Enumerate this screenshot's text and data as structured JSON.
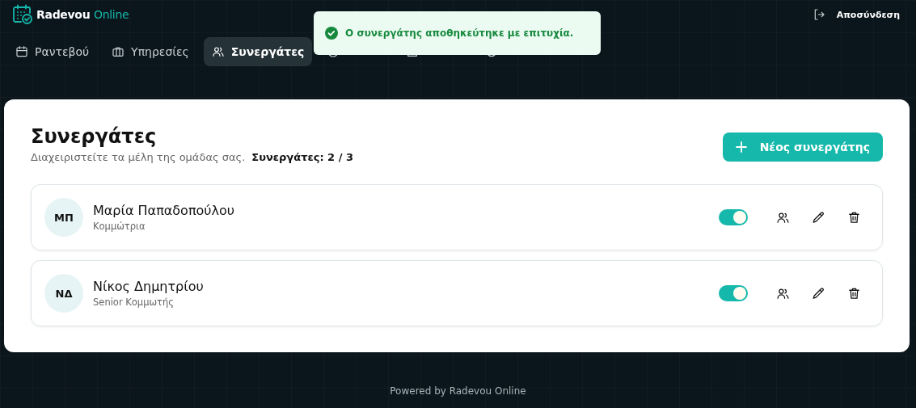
{
  "brand": {
    "name": "Radevou",
    "suffix": "Online"
  },
  "logout": {
    "label": "Αποσύνδεση"
  },
  "tabs": [
    {
      "label": "Ραντεβού",
      "selected": false
    },
    {
      "label": "Υπηρεσίες",
      "selected": false
    },
    {
      "label": "Συνεργάτες",
      "selected": true
    },
    {
      "selected": false
    },
    {
      "selected": false
    },
    {
      "selected": false
    }
  ],
  "toast": {
    "kind": "success",
    "message": "Ο συνεργάτης αποθηκεύτηκε με επιτυχία."
  },
  "page": {
    "title": "Συνεργάτες",
    "subtitle": "Διαχειριστείτε τα μέλη της ομάδας σας.",
    "count": "Συνεργάτες: 2 / 3",
    "new_button": "Νέος συνεργάτης"
  },
  "partners": [
    {
      "initials": "ΜΠ",
      "name": "Μαρία Παπαδοπούλου",
      "role": "Κομμώτρια",
      "on": true
    },
    {
      "initials": "ΝΔ",
      "name": "Νίκος Δημητρίου",
      "role": "Senior Κομμωτής",
      "on": true
    }
  ],
  "footer": "Powered by Radevou Online"
}
